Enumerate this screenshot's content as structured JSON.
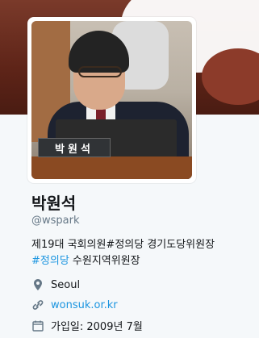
{
  "profile": {
    "name": "박원석",
    "handle": "@wspark",
    "avatar_nameplate": "박원석",
    "bio": {
      "line1": "제19대 국회의원#정의당 경기도당위원장",
      "hashtag": "#정의당",
      "line2_rest": " 수원지역위원장"
    },
    "location": "Seoul",
    "url": "wonsuk.or.kr",
    "joined": "가입일: 2009년 7월"
  },
  "colors": {
    "link": "#1b95e0",
    "secondary_text": "#657786",
    "background": "#f5f8fa"
  },
  "icons": {
    "location": "map-pin-icon",
    "url": "link-icon",
    "joined": "calendar-icon"
  }
}
